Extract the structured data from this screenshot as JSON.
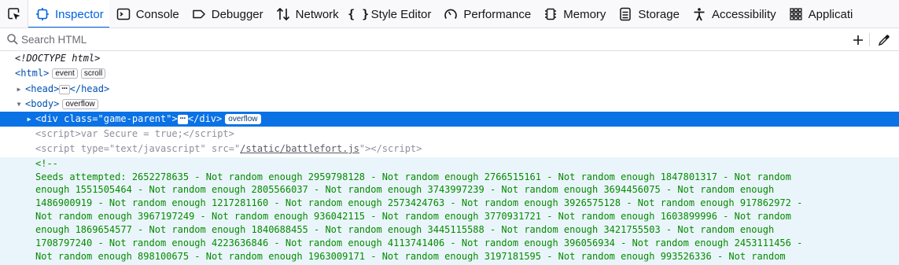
{
  "toolbar": {
    "tabs": [
      {
        "label": "Inspector",
        "icon": "inspector-icon",
        "active": true
      },
      {
        "label": "Console",
        "icon": "console-icon"
      },
      {
        "label": "Debugger",
        "icon": "debugger-icon"
      },
      {
        "label": "Network",
        "icon": "network-icon"
      },
      {
        "label": "Style Editor",
        "icon": "style-editor-icon"
      },
      {
        "label": "Performance",
        "icon": "performance-icon"
      },
      {
        "label": "Memory",
        "icon": "memory-icon"
      },
      {
        "label": "Storage",
        "icon": "storage-icon"
      },
      {
        "label": "Accessibility",
        "icon": "accessibility-icon"
      },
      {
        "label": "Applicati",
        "icon": "application-icon"
      }
    ],
    "accent_color": "#0061e0"
  },
  "search": {
    "placeholder": "Search HTML"
  },
  "tree": {
    "doctype": "<!DOCTYPE html>",
    "html_tag": "html",
    "html_badges": [
      "event",
      "scroll"
    ],
    "head_tag": "head",
    "head_ellipsis": "⋯",
    "body_tag": "body",
    "body_badge": "overflow",
    "div_tag": "div",
    "div_attr": "class",
    "div_value": "\"game-parent\"",
    "div_badge": "overflow",
    "script1_text": "var Secure = true;",
    "script2_type_attr": "type",
    "script2_type_val": "\"text/javascript\"",
    "script2_src_attr": "src",
    "script2_src_val": "/static/battlefort.js",
    "comment_open": "<!--",
    "comment_lines": [
      "Seeds attempted: 2652278635 - Not random enough 2959798128 - Not random enough 2766515161 - Not random enough 1847801317 - Not random",
      "enough 1551505464 - Not random enough 2805566037 - Not random enough 3743997239 - Not random enough 3694456075 - Not random enough",
      "1486900919 - Not random enough 1217281160 - Not random enough 2573424763 - Not random enough 3926575128 - Not random enough 917862972 -",
      "Not random enough 3967197249 - Not random enough 936042115 - Not random enough 3770931721 - Not random enough 1603899996 - Not random",
      "enough 1869654577 - Not random enough 1840688455 - Not random enough 3445115588 - Not random enough 3421755503 - Not random enough",
      "1708797240 - Not random enough 4223636846 - Not random enough 4113741406 - Not random enough 396056934 - Not random enough 2453111456 -",
      "Not random enough 898100675 - Not random enough 1963009171 - Not random enough 3197181595 - Not random enough 993526336 - Not random"
    ],
    "selected_color": "#0a72e5",
    "comment_color": "#058b00"
  }
}
